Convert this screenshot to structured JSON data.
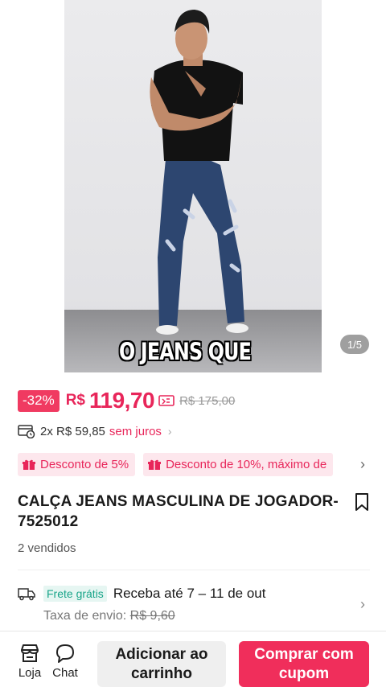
{
  "hero": {
    "caption": "O JEANS QUE",
    "counter": "1/5"
  },
  "price": {
    "discount_badge": "-32%",
    "currency": "R$",
    "amount": "119,70",
    "old_price": "R$ 175,00",
    "accent_color": "#e8265a"
  },
  "installments": {
    "text": "2x R$ 59,85",
    "interest": "sem juros",
    "chevron": "›"
  },
  "promos": [
    {
      "label": "Desconto de 5%"
    },
    {
      "label": "Desconto de 10%, máximo de"
    }
  ],
  "product": {
    "title": "CALÇA JEANS MASCULINA DE JOGADOR-7525012",
    "sold": "2 vendidos"
  },
  "shipping": {
    "badge": "Frete grátis",
    "receive": "Receba até 7 – 11 de out",
    "fee_label": "Taxa de envio:",
    "fee_value": "R$ 9,60"
  },
  "bottom_bar": {
    "store_label": "Loja",
    "chat_label": "Chat",
    "cart_button": "Adicionar ao carrinho",
    "buy_button": "Comprar com cupom",
    "buy_color": "#f02e5b"
  },
  "icons": {
    "coupon": "coupon-icon",
    "installment": "card-clock-icon",
    "promo": "gift-icon",
    "bookmark": "bookmark-icon",
    "truck": "truck-icon",
    "store": "store-icon",
    "chat": "chat-bubble-icon"
  }
}
